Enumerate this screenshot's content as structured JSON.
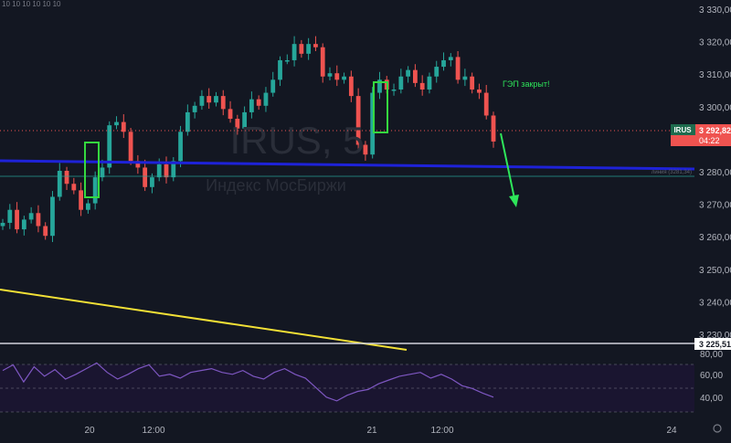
{
  "ohlc_values": "10 10 10 10 10 10",
  "watermark": {
    "symbol": "IRUS, 5",
    "description": "Индекс МосБиржи"
  },
  "annotation_text": "ГЭП закрыт!",
  "hline_label": "линия (3281,34)",
  "price_tag": {
    "symbol": "IRUS",
    "price": "3 292,82",
    "countdown": "04:22"
  },
  "level_tag": "3 225,51",
  "colors": {
    "background": "#131722",
    "up": "#26a69a",
    "down": "#ef5350",
    "trendline_blue": "#1e22d8",
    "trendline_yellow": "#f2e036",
    "box": "#35d93f",
    "arrow": "#2ee65a",
    "rsi": "#7e57c2",
    "level": "#d1d4dc"
  },
  "chart_data": {
    "type": "candlestick",
    "price_axis": {
      "ticks": [
        "3 330,00",
        "3 320,00",
        "3 310,00",
        "3 300,00",
        "3 290,00",
        "3 280,00",
        "3 270,00",
        "3 260,00",
        "3 250,00",
        "3 240,00",
        "3 230,00"
      ],
      "ylim": [
        3222,
        3334
      ]
    },
    "time_axis": {
      "ticks": [
        "20",
        "12:00",
        "21",
        "12:00",
        "24"
      ]
    },
    "series": [
      {
        "name": "IRUS",
        "points_close": [
          3268,
          3272,
          3266,
          3269,
          3271,
          3267,
          3264,
          3276,
          3284,
          3280,
          3278,
          3272,
          3274,
          3282,
          3285,
          3298,
          3299,
          3296,
          3287,
          3285,
          3279,
          3282,
          3286,
          3282,
          3287,
          3296,
          3302,
          3304,
          3307,
          3305,
          3307,
          3303,
          3300,
          3297,
          3302,
          3306,
          3304,
          3308,
          3312,
          3318,
          3318,
          3323,
          3320,
          3323,
          3322,
          3313,
          3314,
          3312,
          3313,
          3307,
          3292,
          3289,
          3308,
          3312,
          3309,
          3309,
          3313,
          3315,
          3311,
          3309,
          3313,
          3316,
          3318,
          3319,
          3312,
          3313,
          3309,
          3308,
          3301,
          3293
        ]
      },
      {
        "name": "RSI",
        "points": [
          64,
          70,
          52,
          68,
          58,
          65,
          55,
          60,
          66,
          72,
          62,
          55,
          60,
          66,
          70,
          58,
          60,
          56,
          62,
          64,
          66,
          62,
          60,
          64,
          58,
          55,
          62,
          66,
          60,
          56,
          46,
          36,
          32,
          38,
          42,
          44,
          50,
          54,
          58,
          60,
          62,
          56,
          60,
          55,
          48,
          45,
          40,
          36
        ]
      }
    ],
    "rsi_axis": {
      "ticks": [
        "80,00",
        "60,00",
        "40,00"
      ],
      "ylim": [
        30,
        80
      ],
      "bands": [
        70,
        50,
        30
      ]
    },
    "annotations": {
      "current_price": 3292.82,
      "horizontal_line": 3281.34,
      "level_line": 3225.51,
      "yellow_trendline": [
        3248,
        3225
      ],
      "boxes": [
        [
          3272,
          3286
        ],
        [
          3293,
          3308
        ]
      ]
    },
    "grid": false
  }
}
